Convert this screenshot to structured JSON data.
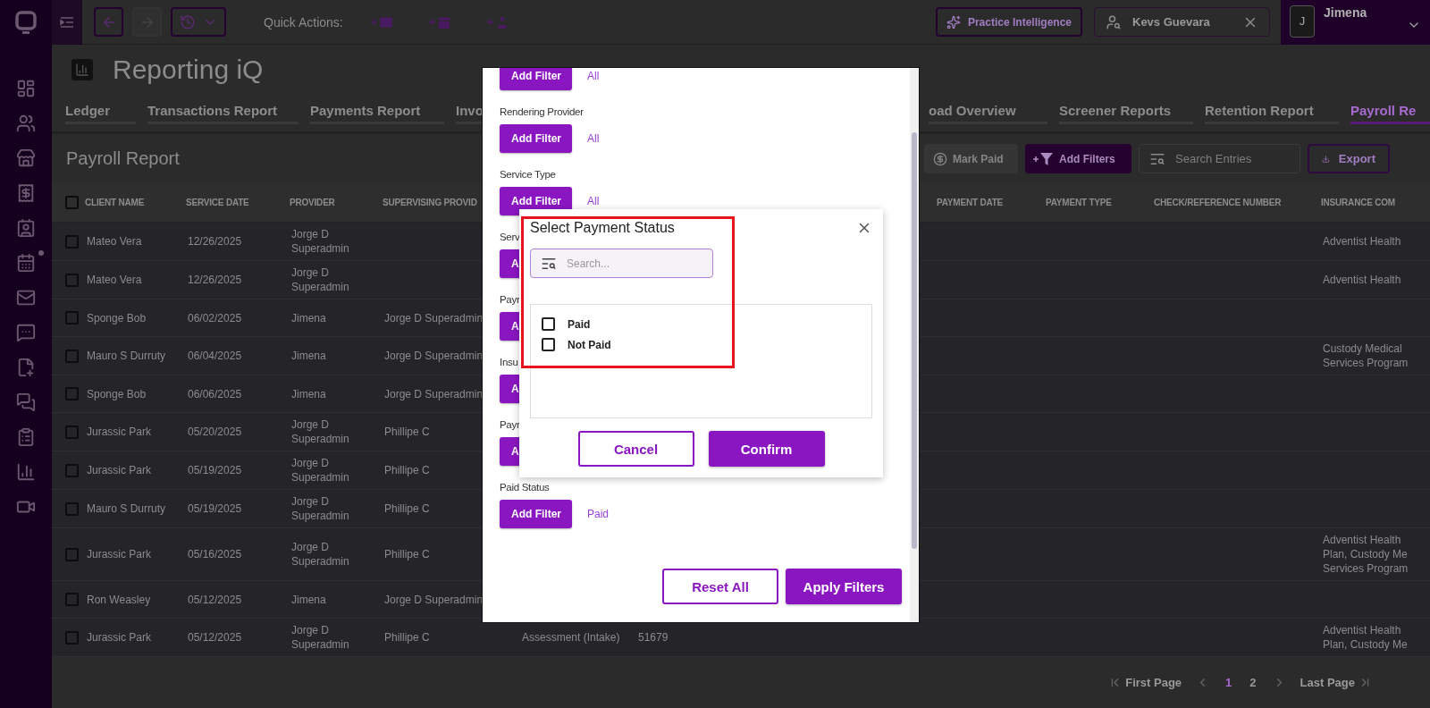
{
  "top_bar": {
    "quick_actions_label": "Quick Actions:",
    "practice_button": "Practice Intelligence",
    "client_chip": "Kevs Guevara",
    "user": {
      "initial": "J",
      "name": "Jimena"
    }
  },
  "page_title": "Reporting iQ",
  "tabs": [
    {
      "label": "Ledger",
      "selected": false
    },
    {
      "label": "Transactions Report",
      "selected": false
    },
    {
      "label": "Payments Report",
      "selected": false
    },
    {
      "label": "Invo",
      "selected": false
    },
    {
      "label": "oad Overview",
      "selected": false
    },
    {
      "label": "Screener Reports",
      "selected": false
    },
    {
      "label": "Retention Report",
      "selected": false
    },
    {
      "label": "Payroll Re",
      "selected": true
    }
  ],
  "report": {
    "title": "Payroll Report",
    "mark_paid": {
      "label": "Mark Paid",
      "disabled": true
    },
    "add_filters": "Add Filters",
    "search_placeholder": "Search Entries",
    "export": "Export"
  },
  "table": {
    "select_all_checked": false,
    "header": {
      "client_name": "CLIENT NAME",
      "service_date": "SERVICE DATE",
      "provider": "PROVIDER",
      "supervising_provider": "SUPERVISING PROVID",
      "payment_date": "PAYMENT DATE",
      "payment_type": "PAYMENT TYPE",
      "check_reference_number": "CHECK/REFERENCE NUMBER",
      "insurance_company": "INSURANCE COM"
    },
    "rows": [
      {
        "checked": false,
        "client_name": "Mateo Vera",
        "service_date": "12/26/2025",
        "provider": "Jorge D Superadmin",
        "insurance_company": "Adventist Health"
      },
      {
        "checked": false,
        "client_name": "Mateo Vera",
        "service_date": "12/26/2025",
        "provider": "Jorge D Superadmin",
        "insurance_company": "Adventist Health"
      },
      {
        "checked": false,
        "client_name": "Sponge Bob",
        "service_date": "06/02/2025",
        "provider": "Jimena",
        "supervising_provider": "Jorge D Superadmin"
      },
      {
        "checked": false,
        "client_name": "Mauro S Durruty",
        "service_date": "06/04/2025",
        "provider": "Jimena",
        "supervising_provider": "Jorge D Superadmin",
        "insurance_company": "Custody Medical Services Program"
      },
      {
        "checked": false,
        "client_name": "Sponge Bob",
        "service_date": "06/06/2025",
        "provider": "Jimena",
        "supervising_provider": "Jorge D Superadmin"
      },
      {
        "checked": false,
        "client_name": "Jurassic Park",
        "service_date": "05/20/2025",
        "provider": "Jorge D Superadmin",
        "supervising_provider": "Phillipe C"
      },
      {
        "checked": false,
        "client_name": "Jurassic Park",
        "service_date": "05/19/2025",
        "provider": "Jorge D Superadmin",
        "supervising_provider": "Phillipe C"
      },
      {
        "checked": false,
        "client_name": "Mauro S Durruty",
        "service_date": "05/19/2025",
        "provider": "Jorge D Superadmin",
        "supervising_provider": "Phillipe C"
      },
      {
        "checked": false,
        "client_name": "Jurassic Park",
        "service_date": "05/16/2025",
        "provider": "Jorge D Superadmin",
        "supervising_provider": "Phillipe C",
        "insurance_company": "Adventist Health Plan, Custody Me Services Program"
      },
      {
        "checked": false,
        "client_name": "Ron Weasley",
        "service_date": "05/12/2025",
        "provider": "Jimena",
        "supervising_provider": "Jorge D Superadmin"
      },
      {
        "checked": false,
        "client_name": "Jurassic Park",
        "service_date": "05/12/2025",
        "provider": "Jorge D Superadmin",
        "supervising_provider": "Phillipe C",
        "column_5": "Assessment (Intake)",
        "column_6": "51679",
        "insurance_company": "Adventist Health Plan, Custody Me"
      }
    ]
  },
  "pagination": {
    "first": "First Page",
    "pages": [
      {
        "label": "1",
        "selected": true
      },
      {
        "label": "2",
        "selected": false
      }
    ],
    "last": "Last Page"
  },
  "filter_modal": {
    "sections": [
      {
        "button": "Add Filter",
        "value": "All"
      },
      {
        "label": "Rendering Provider",
        "button": "Add Filter",
        "value": "All"
      },
      {
        "label": "Service Type",
        "button": "Add Filter",
        "value": "All"
      },
      {
        "label": "Serv",
        "button": "A"
      },
      {
        "label": "Payr",
        "button": "A"
      },
      {
        "label": "Insu",
        "button": "A"
      },
      {
        "label": "Payr",
        "button": "A"
      },
      {
        "label": "Paid Status",
        "button": "Add Filter",
        "value": "Paid"
      }
    ],
    "reset": "Reset All",
    "apply": "Apply Filters"
  },
  "payment_status_dialog": {
    "title": "Select Payment Status",
    "search_placeholder": "Search...",
    "options": [
      {
        "label": "Paid",
        "checked": false
      },
      {
        "label": "Not Paid",
        "checked": false
      }
    ],
    "cancel": "Cancel",
    "confirm": "Confirm"
  }
}
